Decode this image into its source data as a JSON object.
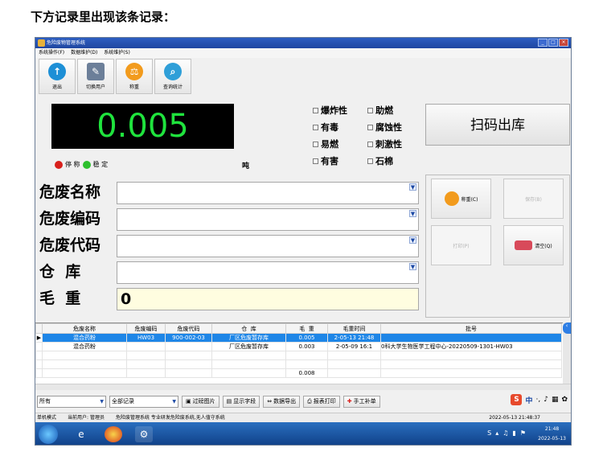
{
  "heading": "下方记录里出现该条记录：",
  "window": {
    "title": "危险废物管理系统",
    "controls": [
      "_",
      "□",
      "×"
    ]
  },
  "menu": [
    "系统操作(F)",
    "数据维护(D)",
    "系统维护(S)"
  ],
  "toolbar": [
    "退出",
    "切换用户",
    "称重",
    "查询统计"
  ],
  "scale": {
    "reading": "0.005",
    "stable_off_label": "停 称",
    "stable_on_label": "稳 定",
    "unit": "吨"
  },
  "hazard_checks": [
    "爆炸性",
    "助燃",
    "有毒",
    "腐蚀性",
    "易燃",
    "刺激性",
    "有害",
    "石棉"
  ],
  "scan_button": "扫码出库",
  "fields": {
    "name_label": "危废名称",
    "code_label": "危废编码",
    "type_code_label": "危废代码",
    "warehouse_label": "仓  库",
    "gross_label": "毛  重",
    "gross_value": "0"
  },
  "right_buttons": {
    "weigh": "称重(C)",
    "save": "保存(B)",
    "print": "打印(P)",
    "clear": "清空(Q)"
  },
  "table": {
    "headers": [
      "危废名称",
      "危废编码",
      "危废代码",
      "仓  库",
      "毛  重",
      "毛重时间",
      "批号"
    ],
    "rows": [
      [
        "混合药粉",
        "HW03",
        "900-002-03",
        "厂区危废暂存库",
        "0.005",
        "2-05-13 21:48",
        ""
      ],
      [
        "混合药粉",
        "",
        "",
        "厂区危废暂存库",
        "0.003",
        "2-05-09 16:1",
        "0科大学生物医学工程中心-20220509-1301-HW03"
      ]
    ],
    "total": "0.008"
  },
  "bottom": {
    "filter1": "所有",
    "filter2": "全部记录",
    "buttons": [
      "过磅图片",
      "显示字段",
      "数据导出",
      "报表打印",
      "手工补单"
    ]
  },
  "ime": "中",
  "status": {
    "left1": "单机模式",
    "left2": "当前用户: 管理员",
    "left3": "危险废管理系统  专业研发危险废系统,无人值守系统",
    "datetime": "2022-05-13 21:48:37"
  },
  "taskbar_clock": {
    "time": "21:48",
    "date": "2022-05-13"
  }
}
